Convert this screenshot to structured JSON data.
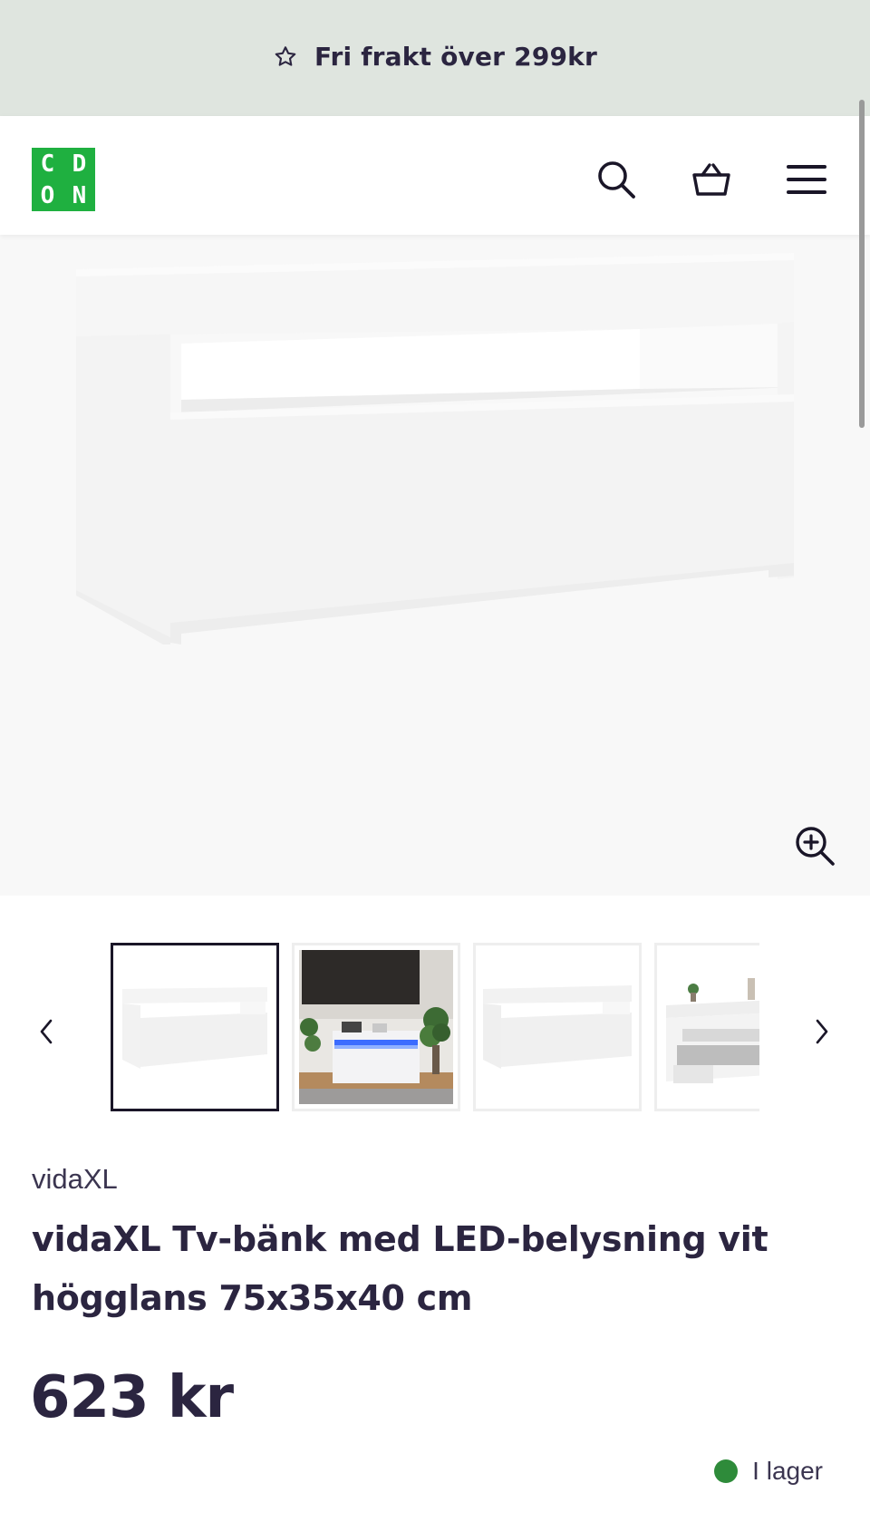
{
  "promo": {
    "icon": "star-outline-icon",
    "text": "Fri frakt över 299kr",
    "background": "#dfe5df"
  },
  "header": {
    "logo": {
      "letters": [
        "C",
        "D",
        "O",
        "N"
      ],
      "color": "#1fb040"
    },
    "icons": [
      "search-icon",
      "basket-icon",
      "menu-icon"
    ]
  },
  "gallery": {
    "zoom_icon": "zoom-in-icon",
    "prev_icon": "chevron-left-icon",
    "next_icon": "chevron-right-icon",
    "selected_index": 0,
    "thumbnails": [
      "tv-bench-front",
      "tv-bench-led-room",
      "tv-bench-front-alt",
      "tv-bench-open-shelf"
    ]
  },
  "product": {
    "brand": "vidaXL",
    "title": "vidaXL Tv-bänk med LED-belysning vit högglans 75x35x40 cm",
    "price": "623 kr",
    "stock_text": "I lager",
    "stock_color": "#2e8b3a"
  }
}
